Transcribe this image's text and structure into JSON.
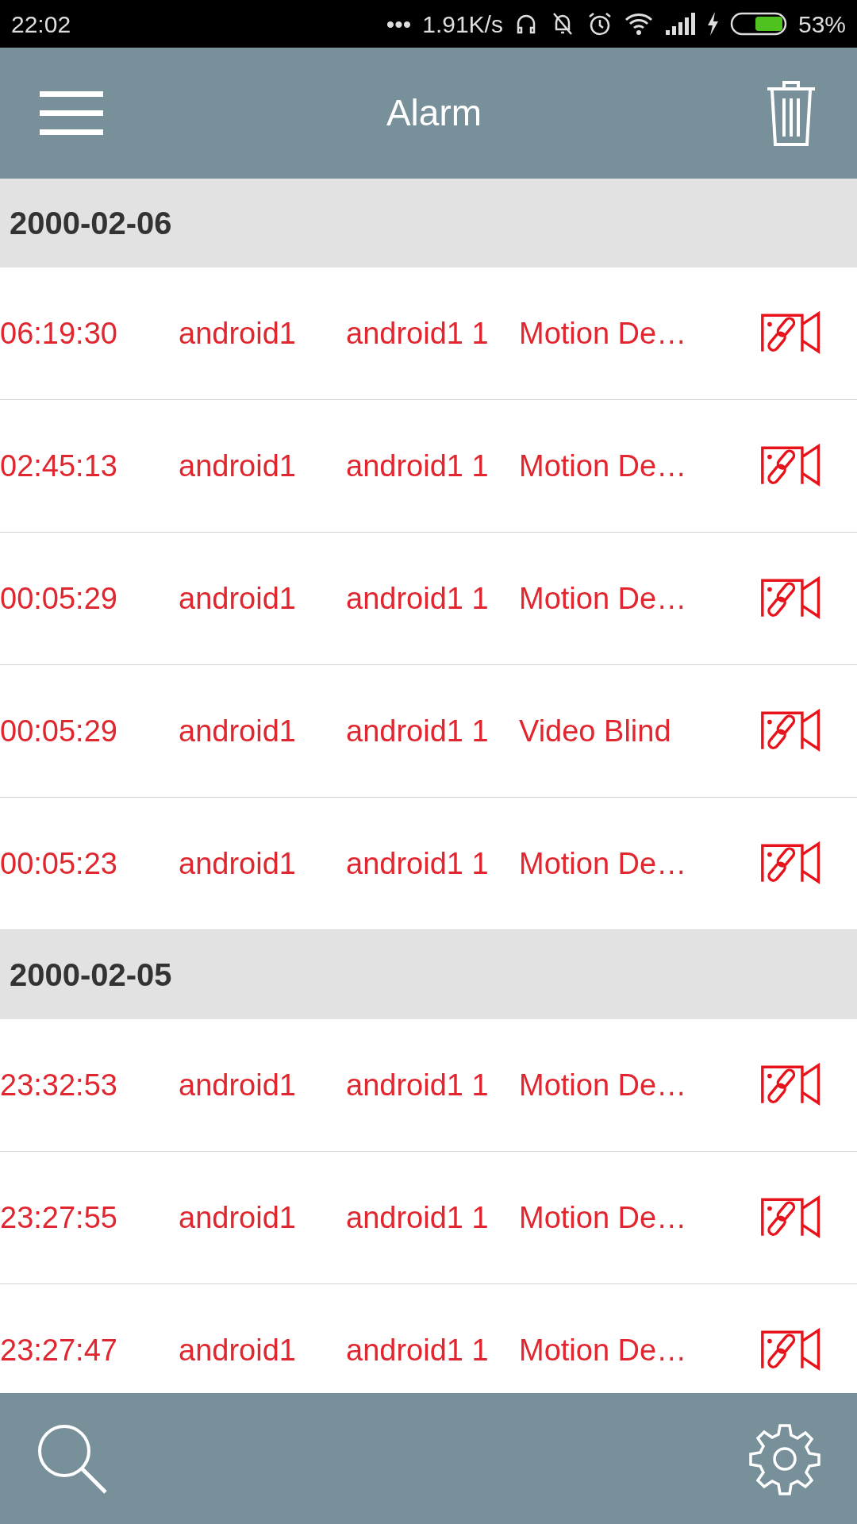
{
  "status_bar": {
    "time": "22:02",
    "dots": "•••",
    "speed": "1.91K/s",
    "battery": "53%"
  },
  "header": {
    "title": "Alarm"
  },
  "groups": [
    {
      "date": "2000-02-06",
      "rows": [
        {
          "time": "06:19:30",
          "device": "android1",
          "channel": "android1 1",
          "type": "Motion De…"
        },
        {
          "time": "02:45:13",
          "device": "android1",
          "channel": "android1 1",
          "type": "Motion De…"
        },
        {
          "time": "00:05:29",
          "device": "android1",
          "channel": "android1 1",
          "type": "Motion De…"
        },
        {
          "time": "00:05:29",
          "device": "android1",
          "channel": "android1 1",
          "type": "Video Blind"
        },
        {
          "time": "00:05:23",
          "device": "android1",
          "channel": "android1 1",
          "type": "Motion De…"
        }
      ]
    },
    {
      "date": "2000-02-05",
      "rows": [
        {
          "time": "23:32:53",
          "device": "android1",
          "channel": "android1 1",
          "type": "Motion De…"
        },
        {
          "time": "23:27:55",
          "device": "android1",
          "channel": "android1 1",
          "type": "Motion De…"
        },
        {
          "time": "23:27:47",
          "device": "android1",
          "channel": "android1 1",
          "type": "Motion De…"
        }
      ]
    }
  ]
}
